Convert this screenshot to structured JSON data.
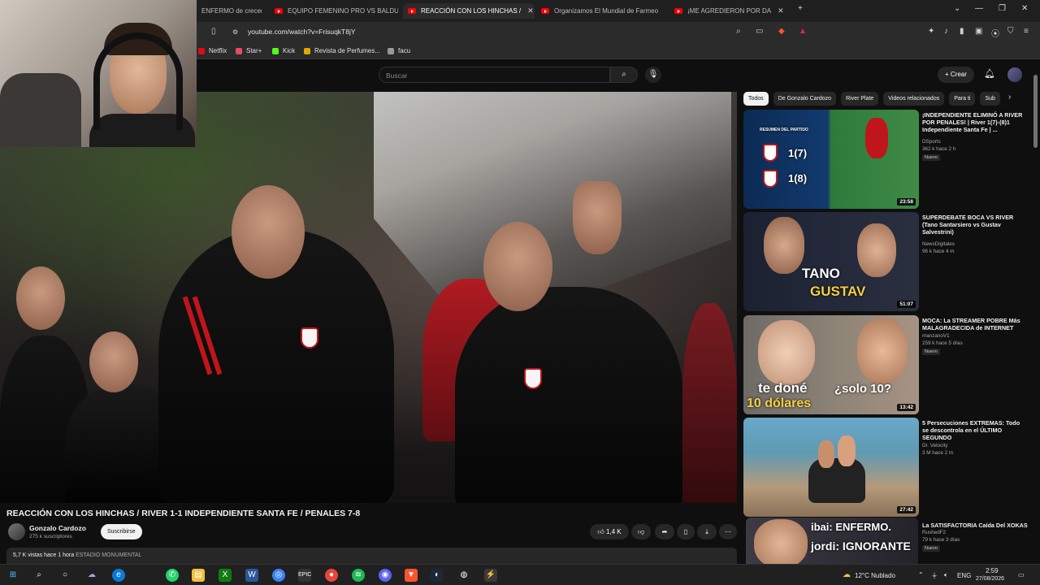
{
  "browser": {
    "tabs": [
      {
        "label": "ENFERMO de crecer e"
      },
      {
        "label": "EQUIPO FEMENINO PRO VS BALDU,"
      },
      {
        "label": "REACCIÓN CON LOS HINCHAS /"
      },
      {
        "label": "Organizamos El Mundial de Farmeo"
      },
      {
        "label": "¡ME AGREDIERON POR DA"
      }
    ],
    "url": "youtube.com/watch?v=FrisuqkT8jY",
    "bookmarks": [
      {
        "label": "Netflix",
        "color": "#e50914"
      },
      {
        "label": "Star+",
        "color": "#e84a5f"
      },
      {
        "label": "Kick",
        "color": "#53fc18"
      },
      {
        "label": "Revista de Perfumes...",
        "color": "#e0a800"
      },
      {
        "label": "facu",
        "color": "#999999"
      }
    ]
  },
  "header": {
    "search_placeholder": "Buscar",
    "create_label": "+ Crear"
  },
  "video": {
    "title": "REACCIÓN CON LOS HINCHAS / RIVER 1-1 INDEPENDIENTE SANTA FE / PENALES 7-8",
    "channel": "Gonzalo Cardozo",
    "subscribers": "275 k suscriptores",
    "subscribe_label": "Suscribirse",
    "likes": "1,4 K",
    "views": "5,7 K vistas  hace 1 hora",
    "location": "ESTADIO MONUMENTAL"
  },
  "sidebar": {
    "chips": [
      "Todos",
      "De Gonzalo Cardozo",
      "River Plate",
      "Videos relacionados",
      "Para ti",
      "Sub"
    ],
    "cards": [
      {
        "title": "¡INDEPENDIENTE ELIMINÓ A RIVER POR PENALES! | River 1(7)-(8)1 Independiente Santa Fe | ...",
        "channel": "DSports",
        "meta": "362 k  hace 2 h",
        "badge": "Nuevo",
        "duration": "23:58",
        "overlay": "RESUMEN DEL PARTIDO"
      },
      {
        "title": "SUPERDEBATE BOCA VS RIVER (Tano Santarsiero vs Gustav Salvestrini)",
        "channel": "NewsDigitales",
        "meta": "96 k  hace 4 m",
        "badge": "",
        "duration": "51:07",
        "overlay_a": "TANO",
        "overlay_b": "GUSTAV"
      },
      {
        "title": "MOCA: La STREAMER POBRE Más MALAGRADECIDA de INTERNET",
        "channel": "manzanoV1",
        "meta": "259 k  hace 5 días",
        "badge": "Nuevo",
        "duration": "13:42",
        "overlay_a": "te doné",
        "overlay_b": "10 dólares",
        "overlay_c": "¿solo 10?"
      },
      {
        "title": "5 Persecuciones EXTREMAS: Todo se descontrola en el ÚLTIMO SEGUNDO",
        "channel": "Dr. Velocity",
        "meta": "3 M  hace 2 m",
        "badge": "",
        "duration": "27:42"
      },
      {
        "title": "La SATISFACTORIA Caída Del XOKAS",
        "channel": "RushedF2",
        "meta": "79 k  hace 3 días",
        "badge": "Nuevo",
        "overlay_a": "ibai: ENFERMO.",
        "overlay_b": "jordi: IGNORANTE"
      }
    ]
  },
  "taskbar": {
    "weather": "12°C  Nublado",
    "lang": "ENG",
    "time": "2:59",
    "date": "27/08/2026"
  }
}
